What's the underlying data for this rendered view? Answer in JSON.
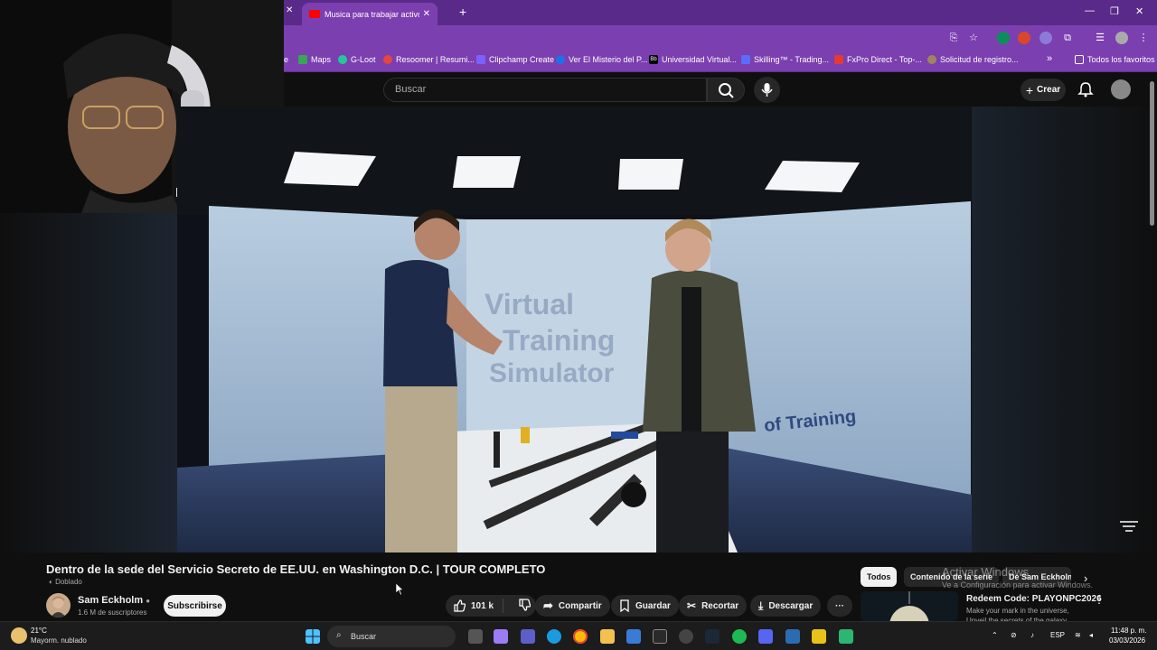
{
  "browser": {
    "tab_title": "Musica para trabajar activo y a",
    "bookmarks": [
      {
        "label": "Maps",
        "color": "#34a853"
      },
      {
        "label": "G-Loot",
        "color": "#20c997"
      },
      {
        "label": "Resoomer | Resumi...",
        "color": "#e8453c"
      },
      {
        "label": "Clipchamp Create",
        "color": "#7b61ff"
      },
      {
        "label": "Ver El Misterio del P...",
        "color": "#1a73e8"
      },
      {
        "label": "Universidad Virtual...",
        "color": "#000000"
      },
      {
        "label": "Skilling™ - Trading...",
        "color": "#5b6cff"
      },
      {
        "label": "FxPro Direct - Top-...",
        "color": "#e53935"
      },
      {
        "label": "Solicitud de registro...",
        "color": "#a0855b"
      }
    ],
    "favorites_label": "Todos los favoritos",
    "more_glyph": "»"
  },
  "youtube": {
    "search_placeholder": "Buscar",
    "create_label": "Crear",
    "video_title": "Dentro de la sede del Servicio Secreto de EE.UU. en Washington D.C. | TOUR COMPLETO",
    "dubbed_label": "Doblado",
    "channel_name": "Sam Eckholm",
    "channel_subs": "1.6 M de suscriptores",
    "subscribe_label": "Subscribirse",
    "likes": "101 k",
    "share_label": "Compartir",
    "save_label": "Guardar",
    "clip_label": "Recortar",
    "download_label": "Descargar",
    "more_label": "···",
    "chips": [
      "Todos",
      "Contenido de la serie",
      "De Sam Eckholm"
    ],
    "rail_title": "Redeem Code: PLAYONPC2026",
    "rail_desc": "Make your mark in the universe,",
    "rail_desc2": "Unveil the secrets of the galaxy",
    "video_banner_word1": "Virtual",
    "video_banner_word2": "Training",
    "video_banner_word3": "Simulator",
    "video_banner_sub": "of Training"
  },
  "watermark": {
    "line1": "Activar Windows",
    "line2": "Ve a Configuración para activar Windows."
  },
  "taskbar": {
    "temp": "21°C",
    "weather": "Mayorm. nublado",
    "search_placeholder": "Buscar",
    "lang": "ESP",
    "time": "11:48 p. m.",
    "date": "03/03/2026"
  }
}
